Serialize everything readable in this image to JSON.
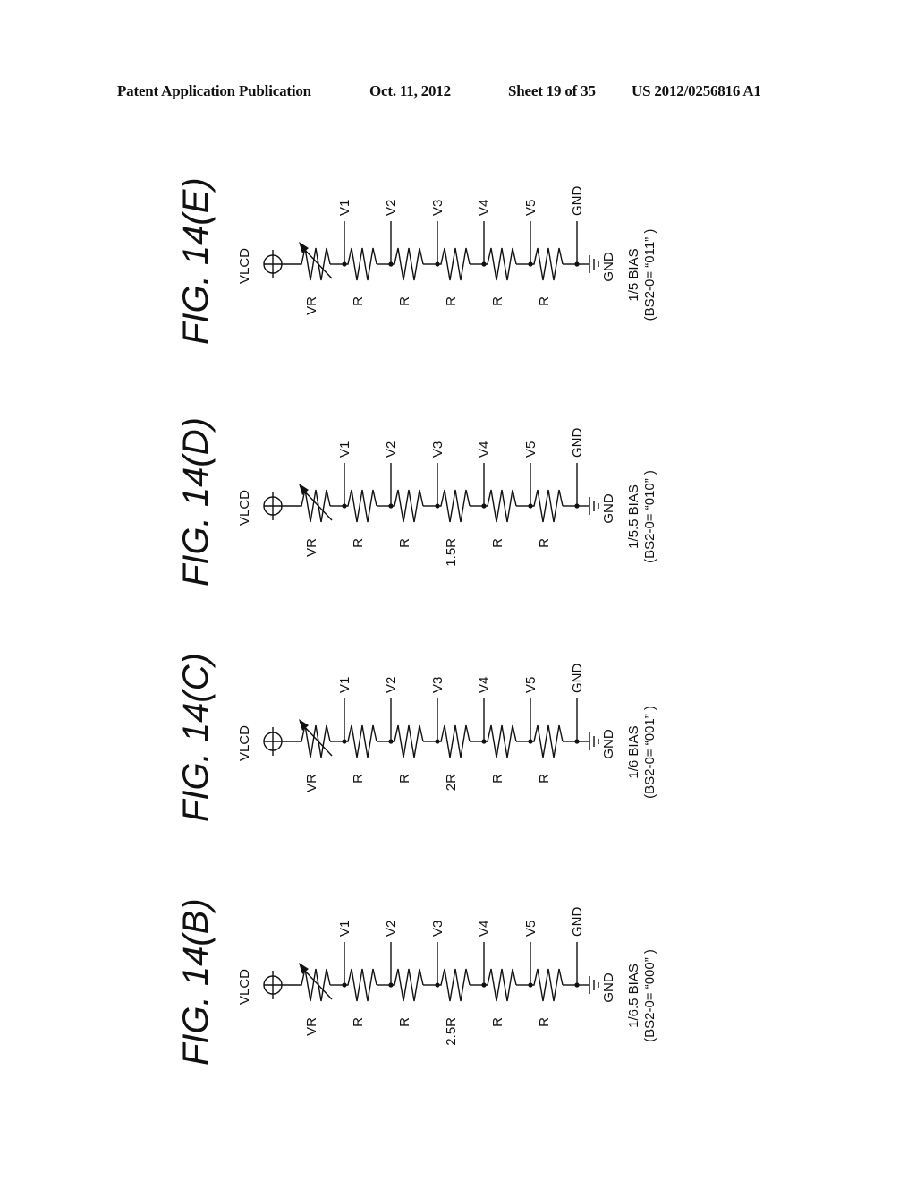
{
  "header": {
    "title": "Patent Application Publication",
    "date": "Oct. 11, 2012",
    "sheet": "Sheet 19 of 35",
    "number": "US 2012/0256816 A1"
  },
  "figures": [
    {
      "id": "B",
      "label": "FIG. 14(B)",
      "supply_label": "VLCD",
      "resistors": [
        "VR",
        "R",
        "R",
        "2.5R",
        "R",
        "R"
      ],
      "taps": [
        "V1",
        "V2",
        "V3",
        "V4",
        "V5",
        "GND"
      ],
      "ground_label": "GND",
      "caption_line1": "1/6.5 BIAS",
      "caption_line2": "(BS2-0= “000” )"
    },
    {
      "id": "C",
      "label": "FIG. 14(C)",
      "supply_label": "VLCD",
      "resistors": [
        "VR",
        "R",
        "R",
        "2R",
        "R",
        "R"
      ],
      "taps": [
        "V1",
        "V2",
        "V3",
        "V4",
        "V5",
        "GND"
      ],
      "ground_label": "GND",
      "caption_line1": "1/6 BIAS",
      "caption_line2": "(BS2-0= “001” )"
    },
    {
      "id": "D",
      "label": "FIG. 14(D)",
      "supply_label": "VLCD",
      "resistors": [
        "VR",
        "R",
        "R",
        "1.5R",
        "R",
        "R"
      ],
      "taps": [
        "V1",
        "V2",
        "V3",
        "V4",
        "V5",
        "GND"
      ],
      "ground_label": "GND",
      "caption_line1": "1/5.5 BIAS",
      "caption_line2": "(BS2-0= “010” )"
    },
    {
      "id": "E",
      "label": "FIG. 14(E)",
      "supply_label": "VLCD",
      "resistors": [
        "VR",
        "R",
        "R",
        "R",
        "R",
        "R"
      ],
      "taps": [
        "V1",
        "V2",
        "V3",
        "V4",
        "V5",
        "GND"
      ],
      "ground_label": "GND",
      "caption_line1": "1/5 BIAS",
      "caption_line2": "(BS2-0= “011” )"
    }
  ]
}
